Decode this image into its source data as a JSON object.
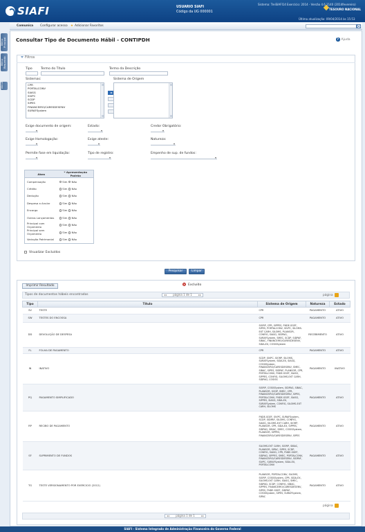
{
  "header": {
    "logo_text": "SIAFI",
    "user_label": "USUARIO SIAFI",
    "user_code": "Código da UG 000001",
    "sys_info": "Sistema: TreiSIAFI14 Exercício: 2014 - Versão 4.6.2140 (2014fevereiro)",
    "brand": "TESOURO NACIONAL",
    "last_update": "Última atualização: 09/04/2014 às 15:53"
  },
  "toolbar": {
    "tabs": [
      "Comunica",
      "Configurar acesso",
      "Adicionar Favoritos"
    ],
    "search_value": ""
  },
  "sidebar": {
    "tabs": [
      "Menu Principal",
      "Menu Resumido",
      "Menu"
    ]
  },
  "page": {
    "title": "Consultar Tipo de Documento Hábil - CONTIPDH",
    "help": "Ajuda"
  },
  "filters": {
    "section": "Filtros",
    "tipo_label": "Tipo",
    "termo_titulo_label": "Termo do Título",
    "termo_descricao_label": "Termo da Descrição",
    "sistemas_label": "Sistemas:",
    "sistemas": [
      "CPR",
      "PORTALCONV",
      "SIASG",
      "SIVPC",
      "SCDP",
      "SIPES",
      "FINANCEIRO/CARESDESENV",
      "SURAFSystem"
    ],
    "origem_label": "Sistema de Origem",
    "exige_doc_label": "Exige documento de origem:",
    "estado_label": "Estado:",
    "credor_label": "Credor Obrigatório:",
    "exige_hom_label": "Exige Homologação:",
    "exige_ateste_label": "Exige ateste:",
    "natureza_label": "Natureza:",
    "fase_label": "Permite fase em liquidação:",
    "tipo_registro_label": "Tipo de registro:",
    "empenho_label": "Empenho de sup. de fundos:",
    "pf_header_abas": "Abas",
    "pf_header_apres": "* Apresentação Padrão",
    "sim": "Sim",
    "nao": "Não",
    "abas": [
      "Compensação",
      "Crédito",
      "Dedução",
      "Despesa a Anular",
      "Encargo",
      "Outros Lançamentos",
      "Principal com Orçamento",
      "Principal sem Orçamento",
      "Variação Patrimonial"
    ],
    "excluidos_label": "Visualizar Excluídos"
  },
  "actions": {
    "pesquisar": "Pesquisar",
    "limpar": "Limpar"
  },
  "results": {
    "print_label": "Imprimir Resultado",
    "excluido_label": "Excluído",
    "caption": "Tipos de documentos hábeis encontrados",
    "pager_text": "página 1 de 1",
    "page_label": "página",
    "columns": [
      "Tipo",
      "Título",
      "Sistema de Origem",
      "Natureza",
      "Estado"
    ],
    "rows": [
      {
        "tipo": "SV",
        "titulo": "TESTE",
        "sistema": "CPR",
        "natureza": "PAGAMENTO",
        "estado": "ATIVO"
      },
      {
        "tipo": "SW",
        "titulo": "TESTES DO ENCOSSA",
        "sistema": "CPR",
        "natureza": "PAGAMENTO",
        "estado": "ATIVO"
      },
      {
        "tipo": "DD",
        "titulo": "DEVOLUÇÃO DE DESPESA",
        "sistema": "SIORP, CPR, SIPPES, FNDE-SGEF, SIPES, PORTALCONV, SIVPC, SILOMS-EXT CARH, SILOMS, PLANSOR, CONFIG, SIASG, SIDPAG, SURAFSystem, SMEC, SCDP, SIDPAF, SIBAC, FINANCEIRO/CARESDESENV, SIDA-EX, COSISSystem",
        "natureza": "RECEBIMENTO",
        "estado": "ATIVO"
      },
      {
        "tipo": "FL",
        "titulo": "FOLHA DE PAGAMENTO",
        "sistema": "CPR",
        "natureza": "PAGAMENTO",
        "estado": "ATIVO"
      },
      {
        "tipo": "IN",
        "titulo": "INATIVO",
        "sistema": "SCDP, SIVPC, SIORP, SILOMS, SURAFSystem, SIDA-EX, SIASG, COSISSystem, FINANCEIRO/CARESDESENV, SMEC, SIBAC, SIPES, SIDPAF, PLANSOR, CPR, PORTALCONV, FNDE-SGEF, SIASG, SIPPES, CONFIG, SILOMS-EXT CARH, SIDPAG, COSISS",
        "natureza": "PAGAMENTO",
        "estado": "INATIVO"
      },
      {
        "tipo": "PQ",
        "titulo": "PAGAMENTO SIMPLIFICADO",
        "sistema": "SIORP, COSISSystem, SIDPAG, SIBAC, PLANSOR, SCDP, SMEC, CPR, FINANCEIRO/CARESDESENV, SIPES, PORTALCONV, FNDE-SGEF, SIASG, SIPPES, SIASG, SIDA-EX, SURAFSystem, CONFIG, SILOMS-EXT CARH, SILOMS",
        "natureza": "PAGAMENTO",
        "estado": "ATIVO"
      },
      {
        "tipo": "RP",
        "titulo": "RECIBO DE PAGAMENTO",
        "sistema": "FNDE-SGEF, SIVPC, SURAFSystem, SCDP, SIDPAF, SILOMS, CONFIG, SIASG, SILOMS-EXT CARH, SIORP, PLANSOR, CPR, SIDA-EX, SIPPES, SIDPAG, SIBAC, SMEC, COSISSystem, PLANSOR, SIPPES, FINANCEIRO/CARESDESENV, SIPES",
        "natureza": "PAGAMENTO",
        "estado": "ATIVO"
      },
      {
        "tipo": "SF",
        "titulo": "SUPRIMENTO DE FUNDOS",
        "sistema": "SILOMS-EXT CARH, SIORP, SIBAC, PLANSOR, SIPAC, SIPES, SCDP, CONFIG, SIASG, CPR, FNDE-SGEF, SIDPAG, SIPPES, SMEC, PORTALCONV, FINANCEIRO/CARESDESENV, SIDPAF, SIVPC, SURAFSystem, SIDA-EX, PORTALCONV",
        "natureza": "PAGAMENTO",
        "estado": "ATIVO"
      },
      {
        "tipo": "TG",
        "titulo": "TESTE VERSIONAMENTO POR EXERCICIO (2012)",
        "sistema": "PLANSOR, PORTALCONV, SILOMS, SIORP, COSISSystem, CPR, SIDA-EX, SILOMS-EXT CARH, SIASG, SMEC, SIDPAG, SCDP, CONFIG, SIBAC, SIPPES, FINANCEIRO/CARESDESENV, SIPES, FNDE-SGEF, SIDPAF, COSISSystem, SIPES, SURAFSystem, SIPAC",
        "natureza": "PAGAMENTO",
        "estado": "ATIVO"
      }
    ]
  },
  "footer": {
    "text": "SIAFI - Sistema Integrado de Administração Financeira do Governo Federal"
  },
  "colors": {
    "header": "#1c5a9c",
    "accent": "#2e6bb3",
    "footer": "#1d4e87"
  }
}
